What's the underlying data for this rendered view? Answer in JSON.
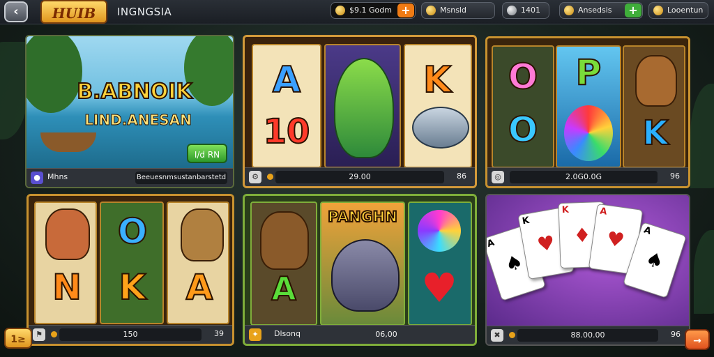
{
  "topbar": {
    "logo": "HUIB",
    "username": "INGNGSIA",
    "balance": "$9.1 Godm",
    "currency1": "Msnsld",
    "currency2": "1401",
    "reward": "Ansedsis",
    "lobby": "Looentun"
  },
  "tiles": [
    {
      "title_line1": "B.ABNOIK",
      "title_line2": "LIND.ANESAN",
      "play_label": "I/d RN",
      "badge": "Mhns",
      "field": "Beeuesnmsustanbarstetd",
      "num": "U"
    },
    {
      "field": "29.00",
      "num": "86",
      "symbols": [
        "A",
        "K",
        "10"
      ]
    },
    {
      "field": "2.0G0.0G",
      "num": "96",
      "symbols": [
        "O",
        "P",
        "O",
        "K"
      ]
    },
    {
      "field": "150",
      "num": "39",
      "symbols": [
        "O",
        "N",
        "K",
        "A"
      ]
    },
    {
      "banner": "PANGHN",
      "field": "Dlsonq",
      "field_value": "06,00",
      "num": ""
    },
    {
      "field": "88.00.00",
      "num": "96",
      "cards": [
        "A",
        "K",
        "K",
        "A",
        "A"
      ]
    }
  ],
  "footer": {
    "left_button": "1≥",
    "right_button": "→"
  }
}
